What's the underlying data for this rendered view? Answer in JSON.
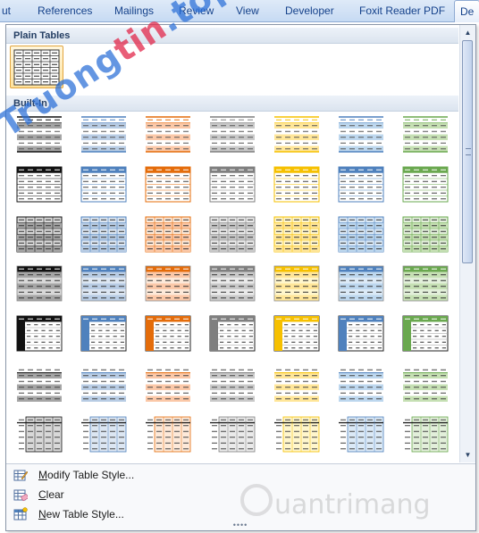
{
  "ribbon": {
    "tabs": [
      {
        "label": "ut",
        "selected": false
      },
      {
        "label": "References",
        "selected": false
      },
      {
        "label": "Mailings",
        "selected": false
      },
      {
        "label": "Review",
        "selected": false
      },
      {
        "label": "View",
        "selected": false
      },
      {
        "label": "Developer",
        "selected": false
      },
      {
        "label": "Foxit Reader PDF",
        "selected": false
      },
      {
        "label": "De",
        "selected": true
      }
    ]
  },
  "gallery": {
    "sections": [
      {
        "label": "Plain Tables"
      },
      {
        "label": "Built-In"
      }
    ],
    "plain_tables": [
      {
        "name": "Table Grid",
        "accent": "#555555",
        "selected": true
      }
    ],
    "builtin_colors": [
      "#000000",
      "#4f81bd",
      "#c0504d",
      "#9bbb59",
      "#f79646",
      "#4bacc6",
      "#8064a2"
    ],
    "palette": [
      {
        "name": "black",
        "accent": "#111111",
        "light": "#d8d8d8",
        "mid": "#a5a5a5"
      },
      {
        "name": "blue",
        "accent": "#4f81bd",
        "light": "#dce6f2",
        "mid": "#b8cce4"
      },
      {
        "name": "orange",
        "accent": "#e46c0a",
        "light": "#fde9d9",
        "mid": "#fbc8a8"
      },
      {
        "name": "gray",
        "accent": "#7f7f7f",
        "light": "#eaeaea",
        "mid": "#c9c9c9"
      },
      {
        "name": "gold",
        "accent": "#f6c000",
        "light": "#fff6cc",
        "mid": "#ffe699"
      },
      {
        "name": "teal",
        "accent": "#4f81bd",
        "light": "#dbe9f6",
        "mid": "#bdd7ee"
      },
      {
        "name": "green",
        "accent": "#6aa84f",
        "light": "#e2efda",
        "mid": "#c6e0b4"
      }
    ],
    "rows": [
      "light-shading",
      "light-list",
      "light-grid",
      "medium-shading",
      "medium-list-accent",
      "medium-shading-2",
      "medium-grid-partial"
    ]
  },
  "menu": {
    "items": [
      {
        "label": "Modify Table Style...",
        "mnemonic": "M",
        "rest": "odify Table Style...",
        "icon": "modify-table-style-icon"
      },
      {
        "label": "Clear",
        "mnemonic": "C",
        "rest": "lear",
        "icon": "clear-table-style-icon"
      },
      {
        "label": "New Table Style...",
        "mnemonic": "N",
        "rest": "ew Table Style...",
        "icon": "new-table-style-icon"
      }
    ]
  },
  "watermarks": {
    "top_left": {
      "prefix": "Truong",
      "accent": "tin",
      "suffix": ".top"
    },
    "bottom_right": {
      "text": "uantrimang"
    }
  }
}
